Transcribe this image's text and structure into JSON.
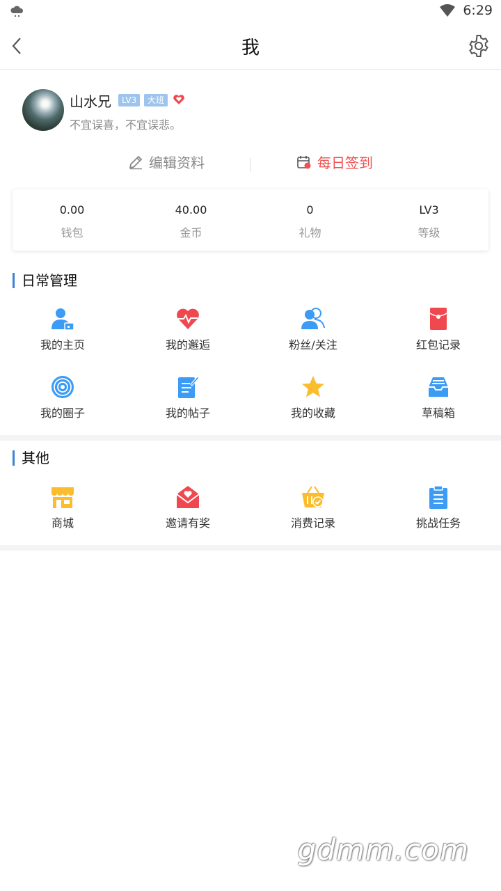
{
  "status": {
    "time": "6:29"
  },
  "nav": {
    "title": "我"
  },
  "profile": {
    "username": "山水兄",
    "level_badge": "LV3",
    "class_badge": "大班",
    "signature": "不宜误喜，不宜误悲。"
  },
  "actions": {
    "edit": "编辑资料",
    "sign_in": "每日签到"
  },
  "stats": [
    {
      "value": "0.00",
      "label": "钱包"
    },
    {
      "value": "40.00",
      "label": "金币"
    },
    {
      "value": "0",
      "label": "礼物"
    },
    {
      "value": "LV3",
      "label": "等级"
    }
  ],
  "daily": {
    "title": "日常管理",
    "items": [
      {
        "label": "我的主页",
        "icon": "user-home-icon"
      },
      {
        "label": "我的邂逅",
        "icon": "heart-pulse-icon"
      },
      {
        "label": "粉丝/关注",
        "icon": "followers-icon"
      },
      {
        "label": "红包记录",
        "icon": "red-envelope-icon"
      },
      {
        "label": "我的圈子",
        "icon": "circle-target-icon"
      },
      {
        "label": "我的帖子",
        "icon": "post-edit-icon"
      },
      {
        "label": "我的收藏",
        "icon": "star-icon"
      },
      {
        "label": "草稿箱",
        "icon": "drafts-inbox-icon"
      }
    ]
  },
  "other": {
    "title": "其他",
    "items": [
      {
        "label": "商城",
        "icon": "shop-icon"
      },
      {
        "label": "邀请有奖",
        "icon": "invite-mail-icon"
      },
      {
        "label": "消费记录",
        "icon": "basket-check-icon"
      },
      {
        "label": "挑战任务",
        "icon": "clipboard-icon"
      }
    ]
  },
  "colors": {
    "accent_blue": "#3b9bf5",
    "accent_red": "#f0484e",
    "accent_yellow": "#fbbd2e"
  },
  "watermark": "gdmm.com"
}
